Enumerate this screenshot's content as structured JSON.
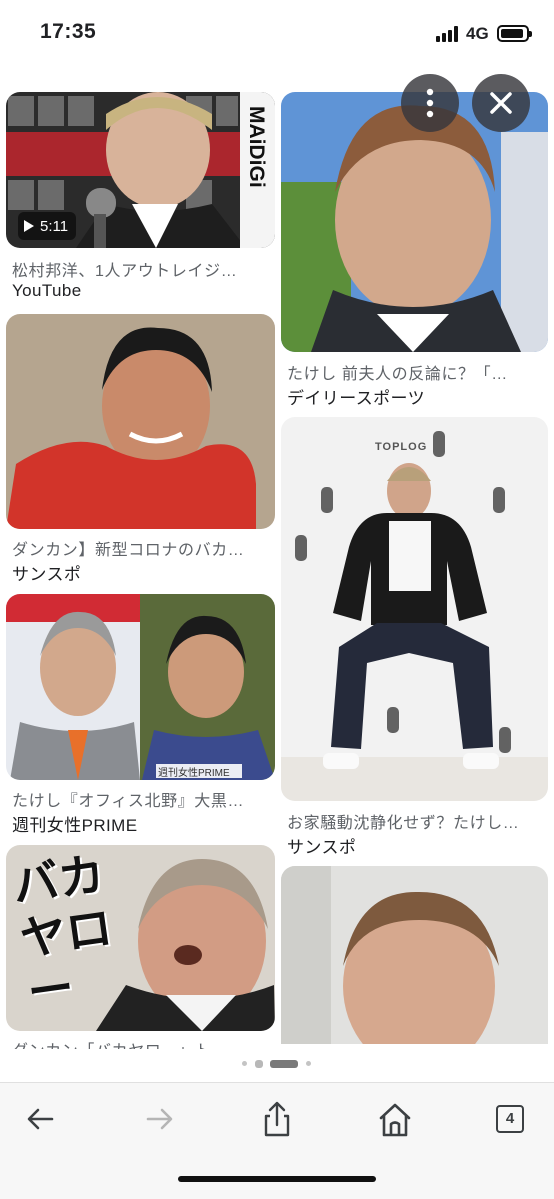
{
  "status_bar": {
    "time": "17:35",
    "network": "4G"
  },
  "overlay_buttons": {
    "more_icon": "more-vertical-icon",
    "close_icon": "close-icon"
  },
  "results": [
    {
      "caption": "松村邦洋、1人アウトレイジ…",
      "source": "YouTube",
      "duration": "5:11",
      "thumb_text": "MAiDiGi"
    },
    {
      "caption": "たけし 前夫人の反論に？「…",
      "source": "デイリースポーツ"
    },
    {
      "caption": "ダンカン】新型コロナのバカ…",
      "source": "サンスポ"
    },
    {
      "caption": "お家騒動沈静化せず？たけし…",
      "source": "サンスポ",
      "thumb_text": "TOPLOG"
    },
    {
      "caption": "たけし『オフィス北野』大黒…",
      "source": "週刊女性PRIME",
      "thumb_text": "週刊女性PRIME"
    },
    {
      "caption": "ダンカン「バカヤロー」ト…",
      "source": "",
      "thumb_text": "バカヤロー"
    },
    {
      "caption": "",
      "source": ""
    }
  ],
  "carousel": {
    "pages": 4,
    "active": 2
  },
  "toolbar": {
    "back_icon": "back-arrow-icon",
    "forward_icon": "forward-arrow-icon",
    "share_icon": "share-icon",
    "home_icon": "home-icon",
    "tab_count": "4"
  },
  "colors": {
    "overlay_button": "#37373c",
    "caption": "#5f6368",
    "toolbar_bg": "#f7f7f7"
  }
}
